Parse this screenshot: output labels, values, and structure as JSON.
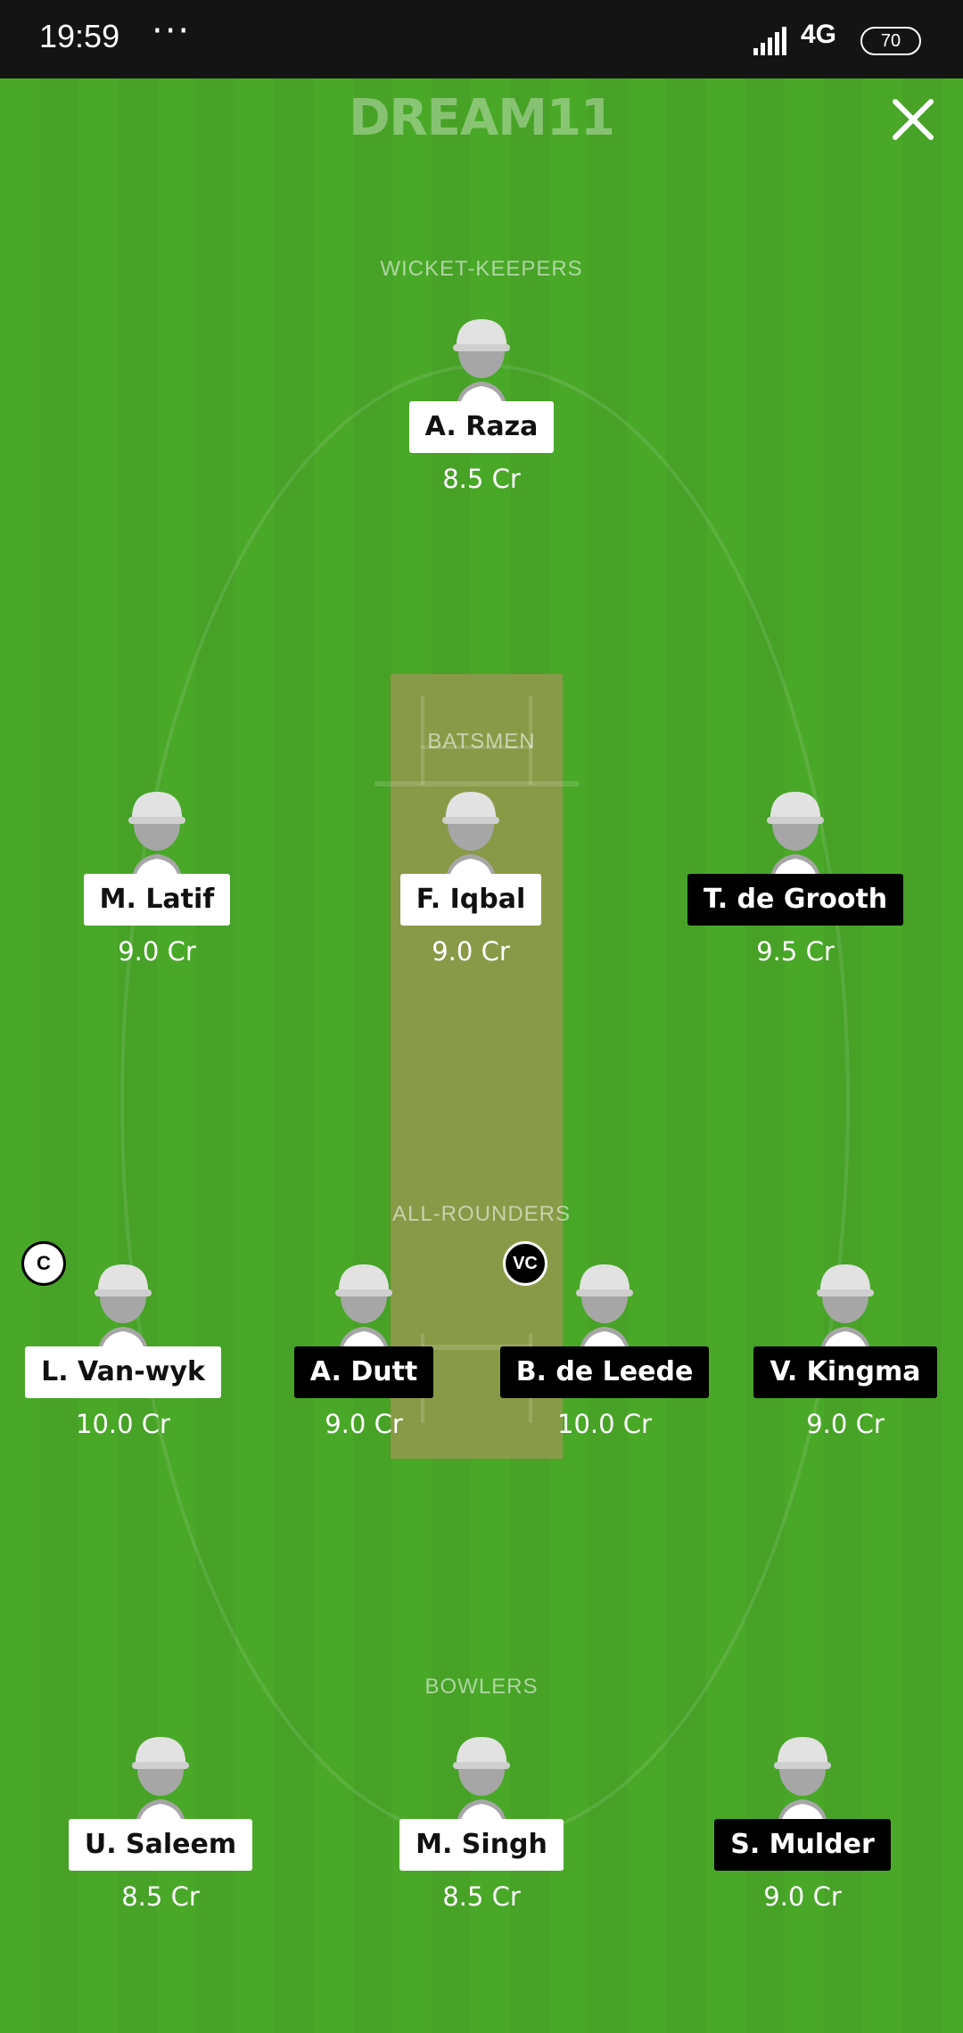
{
  "status_bar": {
    "time": "19:59",
    "dots": "···",
    "network": "4G",
    "battery": "70"
  },
  "header": {
    "logo": "DREAM11"
  },
  "sections": {
    "wicket_keepers": "WICKET-KEEPERS",
    "batsmen": "BATSMEN",
    "all_rounders": "ALL-ROUNDERS",
    "bowlers": "BOWLERS"
  },
  "players": {
    "wk1": {
      "name": "A. Raza",
      "credits": "8.5 Cr"
    },
    "bat1": {
      "name": "M. Latif",
      "credits": "9.0 Cr"
    },
    "bat2": {
      "name": "F. Iqbal",
      "credits": "9.0 Cr"
    },
    "bat3": {
      "name": "T. de Grooth",
      "credits": "9.5 Cr"
    },
    "ar1": {
      "name": "L. Van-wyk",
      "credits": "10.0 Cr",
      "badge": "C"
    },
    "ar2": {
      "name": "A. Dutt",
      "credits": "9.0 Cr"
    },
    "ar3": {
      "name": "B. de Leede",
      "credits": "10.0 Cr",
      "badge": "VC"
    },
    "ar4": {
      "name": "V. Kingma",
      "credits": "9.0 Cr"
    },
    "bowl1": {
      "name": "U. Saleem",
      "credits": "8.5 Cr"
    },
    "bowl2": {
      "name": "M. Singh",
      "credits": "8.5 Cr"
    },
    "bowl3": {
      "name": "S. Mulder",
      "credits": "9.0 Cr"
    }
  },
  "colors": {
    "field": "#4aa829",
    "pitch": "#889a47",
    "team_a_label": "#ffffff",
    "team_b_label": "#000000"
  }
}
